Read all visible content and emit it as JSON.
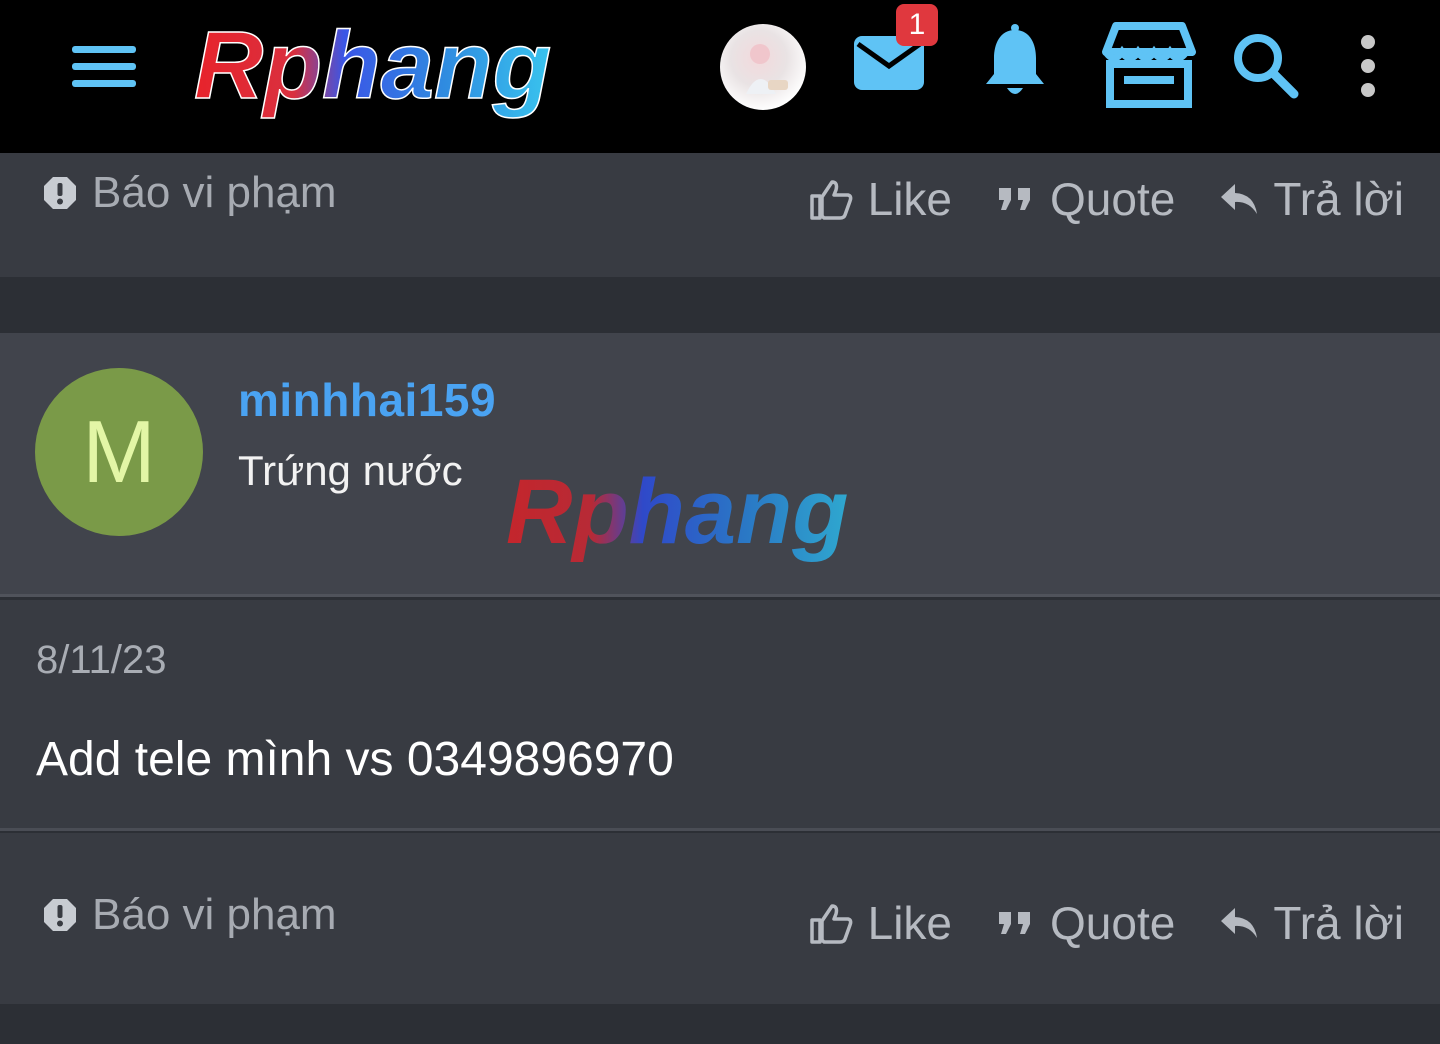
{
  "header": {
    "logo_text": "Rphang",
    "notification_badge": "1",
    "icons": [
      "menu-icon",
      "avatar",
      "mail-icon",
      "bell-icon",
      "shop-icon",
      "search-icon",
      "more-icon"
    ],
    "accent_color": "#5fc3f5"
  },
  "post_prev": {
    "report_label": "Báo vi phạm",
    "like_label": "Like",
    "quote_label": "Quote",
    "reply_label": "Trả lời"
  },
  "post": {
    "avatar_letter": "M",
    "avatar_color": "#7a9a48",
    "username": "minhhai159",
    "user_title": "Trứng nước",
    "watermark_text": "Rphang",
    "date": "8/11/23",
    "message": "Add tele mình vs 0349896970",
    "report_label": "Báo vi phạm",
    "like_label": "Like",
    "quote_label": "Quote",
    "reply_label": "Trả lời"
  }
}
